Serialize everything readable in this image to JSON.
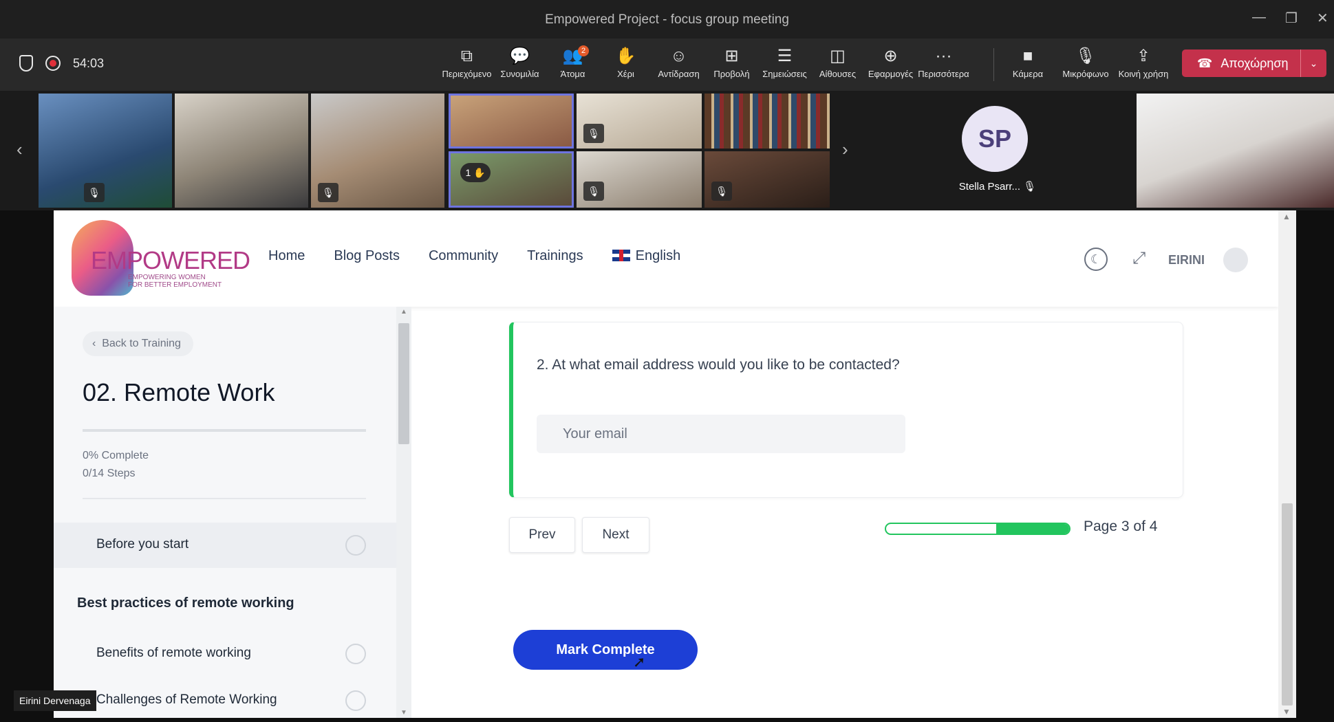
{
  "window": {
    "title": "Empowered Project - focus group meeting"
  },
  "call": {
    "timer": "54:03",
    "toolbar": [
      {
        "label": "Περιεχόμενο",
        "icon": "open-content-icon"
      },
      {
        "label": "Συνομιλία",
        "icon": "chat-icon"
      },
      {
        "label": "Άτομα",
        "icon": "people-icon",
        "badge": "2"
      },
      {
        "label": "Χέρι",
        "icon": "raise-hand-icon"
      },
      {
        "label": "Αντίδραση",
        "icon": "reaction-icon"
      },
      {
        "label": "Προβολή",
        "icon": "view-icon"
      },
      {
        "label": "Σημειώσεις",
        "icon": "notes-icon"
      },
      {
        "label": "Αίθουσες",
        "icon": "rooms-icon"
      },
      {
        "label": "Εφαρμογές",
        "icon": "apps-icon"
      },
      {
        "label": "Περισσότερα",
        "icon": "more-icon"
      }
    ],
    "media": [
      {
        "label": "Κάμερα",
        "icon": "camera-icon"
      },
      {
        "label": "Μικρόφωνο",
        "icon": "microphone-icon"
      },
      {
        "label": "Κοινή χρήση",
        "icon": "share-icon"
      }
    ],
    "leave_label": "Αποχώρηση",
    "raised_hand_count": "1",
    "spotlight": {
      "initials": "SP",
      "name": "Stella Psarr..."
    },
    "presenter_name": "Eirini Dervenaga"
  },
  "site": {
    "logo": {
      "word": "EMPOWERED",
      "tagline_1": "EMPOWERING WOMEN",
      "tagline_2": "FOR BETTER EMPLOYMENT"
    },
    "nav": {
      "items": [
        "Home",
        "Blog Posts",
        "Community",
        "Trainings"
      ],
      "language": "English"
    },
    "user": {
      "name": "EIRINI"
    },
    "sidebar": {
      "back_label": "Back to Training",
      "title": "02. Remote Work",
      "complete": "0% Complete",
      "steps": "0/14 Steps",
      "lesson_1": "Before you start",
      "section": "Best practices of remote working",
      "lesson_2": "Benefits of remote working",
      "lesson_3": "Challenges of Remote Working"
    },
    "question": {
      "text": "2. At what email address would you like to be contacted?",
      "placeholder": "Your email"
    },
    "pager": {
      "prev": "Prev",
      "next": "Next",
      "page_text": "Page 3 of 4",
      "progress_start": 0.6,
      "progress_end": 1.0
    },
    "mark_complete": "Mark Complete"
  },
  "colors": {
    "accent_green": "#22c55e",
    "button_blue": "#1d3fd6",
    "leave_red": "#c4314b"
  }
}
